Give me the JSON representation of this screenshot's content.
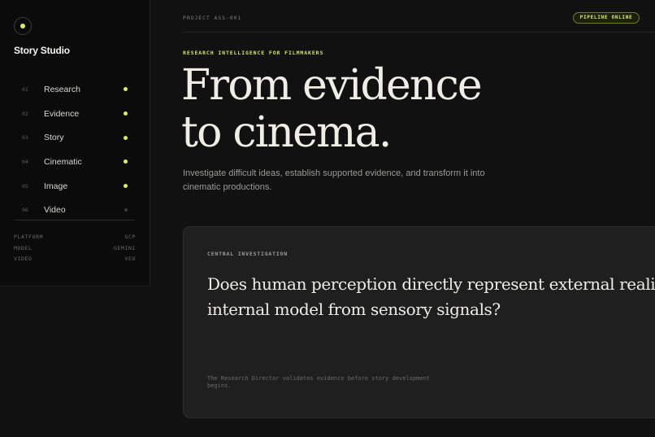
{
  "brand": {
    "name": "Story Studio",
    "accent": "#d4f25a"
  },
  "nav": [
    {
      "num": "01",
      "label": "Research",
      "status": "active"
    },
    {
      "num": "02",
      "label": "Evidence",
      "status": "active"
    },
    {
      "num": "03",
      "label": "Story",
      "status": "active"
    },
    {
      "num": "04",
      "label": "Cinematic",
      "status": "active"
    },
    {
      "num": "05",
      "label": "Image",
      "status": "active"
    },
    {
      "num": "06",
      "label": "Video",
      "status": "inactive"
    }
  ],
  "meta": [
    {
      "key": "PLATFORM",
      "value": "GCP"
    },
    {
      "key": "MODEL",
      "value": "GEMINI"
    },
    {
      "key": "VIDEO",
      "value": "VEO"
    }
  ],
  "topbar": {
    "project": "PROJECT ASS-001",
    "status": "PIPELINE ONLINE"
  },
  "hero": {
    "eyebrow": "RESEARCH INTELLIGENCE FOR FILMMAKERS",
    "title_line1": "From evidence",
    "title_line2": "to cinema.",
    "subtitle": "Investigate difficult ideas, establish supported evidence, and transform it into cinematic productions."
  },
  "card": {
    "label": "CENTRAL INVESTIGATION",
    "question_line1": "Does human perception directly represent external reality, or construct an",
    "question_line2": "internal model from sensory signals?",
    "note": "The Research Director validates evidence before story development begins."
  }
}
